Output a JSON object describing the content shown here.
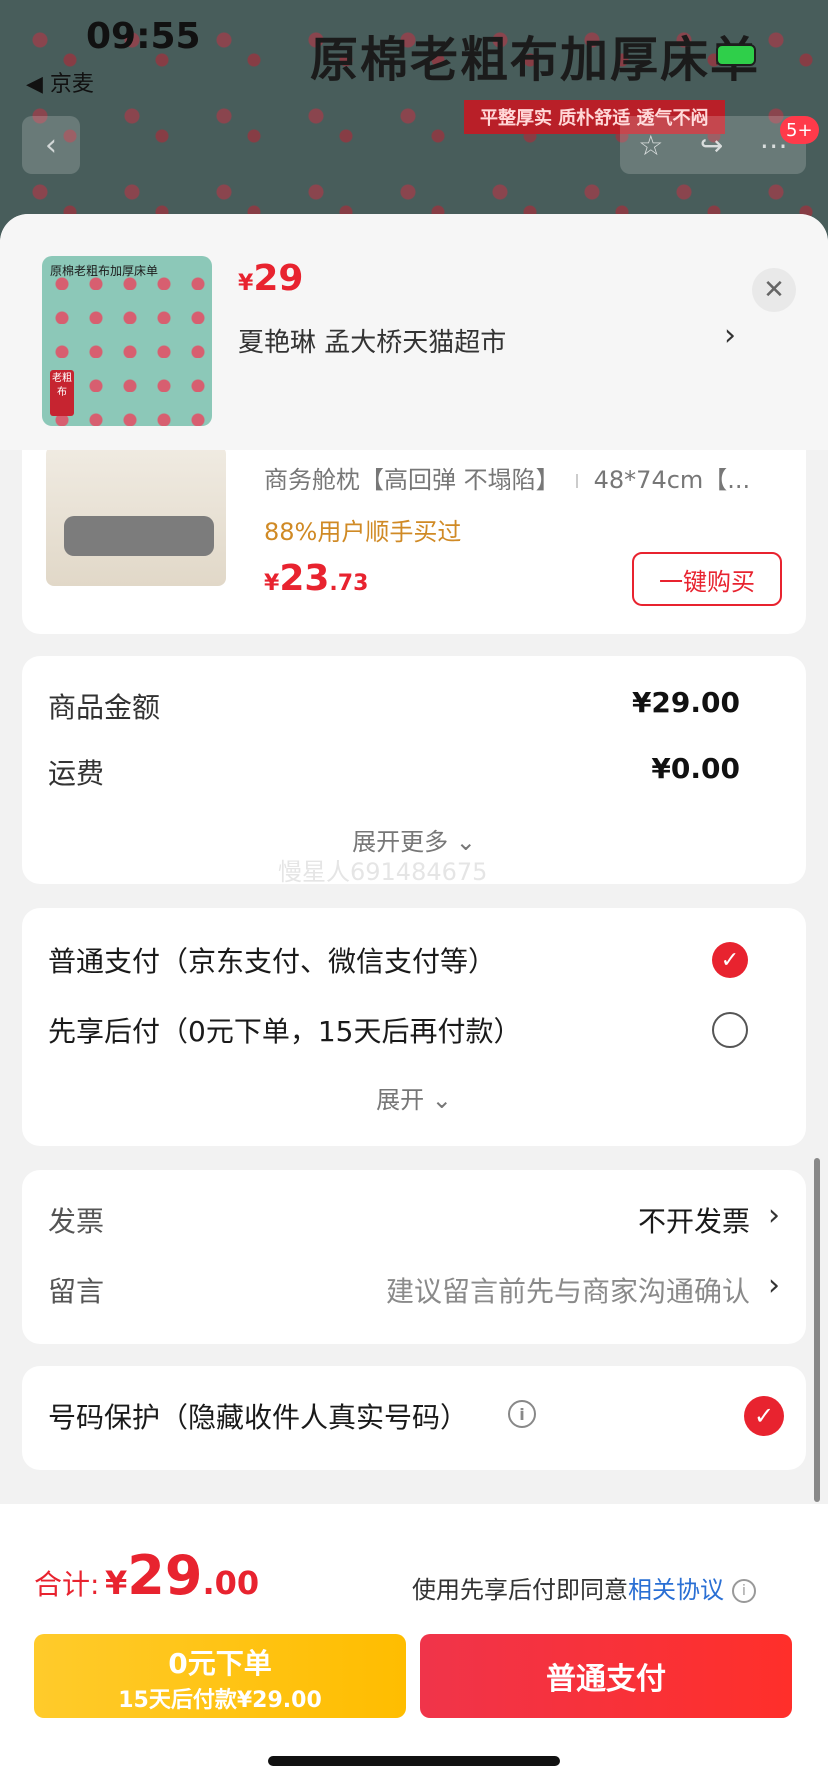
{
  "status": {
    "time": "09:55",
    "back_app": "◀ 京麦"
  },
  "banner": {
    "title": "原棉老粗布加厚床单",
    "subtitle": "平整厚实 质朴舒适 透气不闷",
    "badge": "5+"
  },
  "sheet_header": {
    "thumb_title": "原棉老粗布加厚床单",
    "thumb_stamp": "老粗布",
    "price_symbol": "¥",
    "price": "29",
    "shop": "夏艳琳  孟大桥天猫超市"
  },
  "recommended": {
    "title_part1": "商务舱枕【高回弹 不塌陷】",
    "title_part2": "48*74cm【...",
    "hint": "88%用户顺手买过",
    "price_symbol": "¥",
    "price_int": "23",
    "price_dec": ".73",
    "buy_label": "一键购买"
  },
  "amounts": {
    "goods_label": "商品金额",
    "goods_value": "¥29.00",
    "shipping_label": "运费",
    "shipping_value": "¥0.00",
    "expand_label": "展开更多 ⌄",
    "watermark": "慢星人691484675"
  },
  "payment": {
    "option_normal": "普通支付（京东支付、微信支付等）",
    "option_later": "先享后付（0元下单，15天后再付款）",
    "expand_label": "展开 ⌄"
  },
  "invoice": {
    "invoice_label": "发票",
    "invoice_value": "不开发票",
    "note_label": "留言",
    "note_placeholder": "建议留言前先与商家沟通确认"
  },
  "protect": {
    "label": "号码保护（隐藏收件人真实号码）"
  },
  "footer": {
    "total_label": "合计:",
    "total_symbol": "¥",
    "total_int": "29",
    "total_dec": ".00",
    "agree_text": "使用先享后付即同意",
    "agree_link": "相关协议",
    "later_line1": "0元下单",
    "later_line2": "15天后付款¥29.00",
    "normal_label": "普通支付"
  },
  "colors": {
    "accent": "#e8232f",
    "yellow": "#ffbd00",
    "link": "#2a6fd4"
  }
}
